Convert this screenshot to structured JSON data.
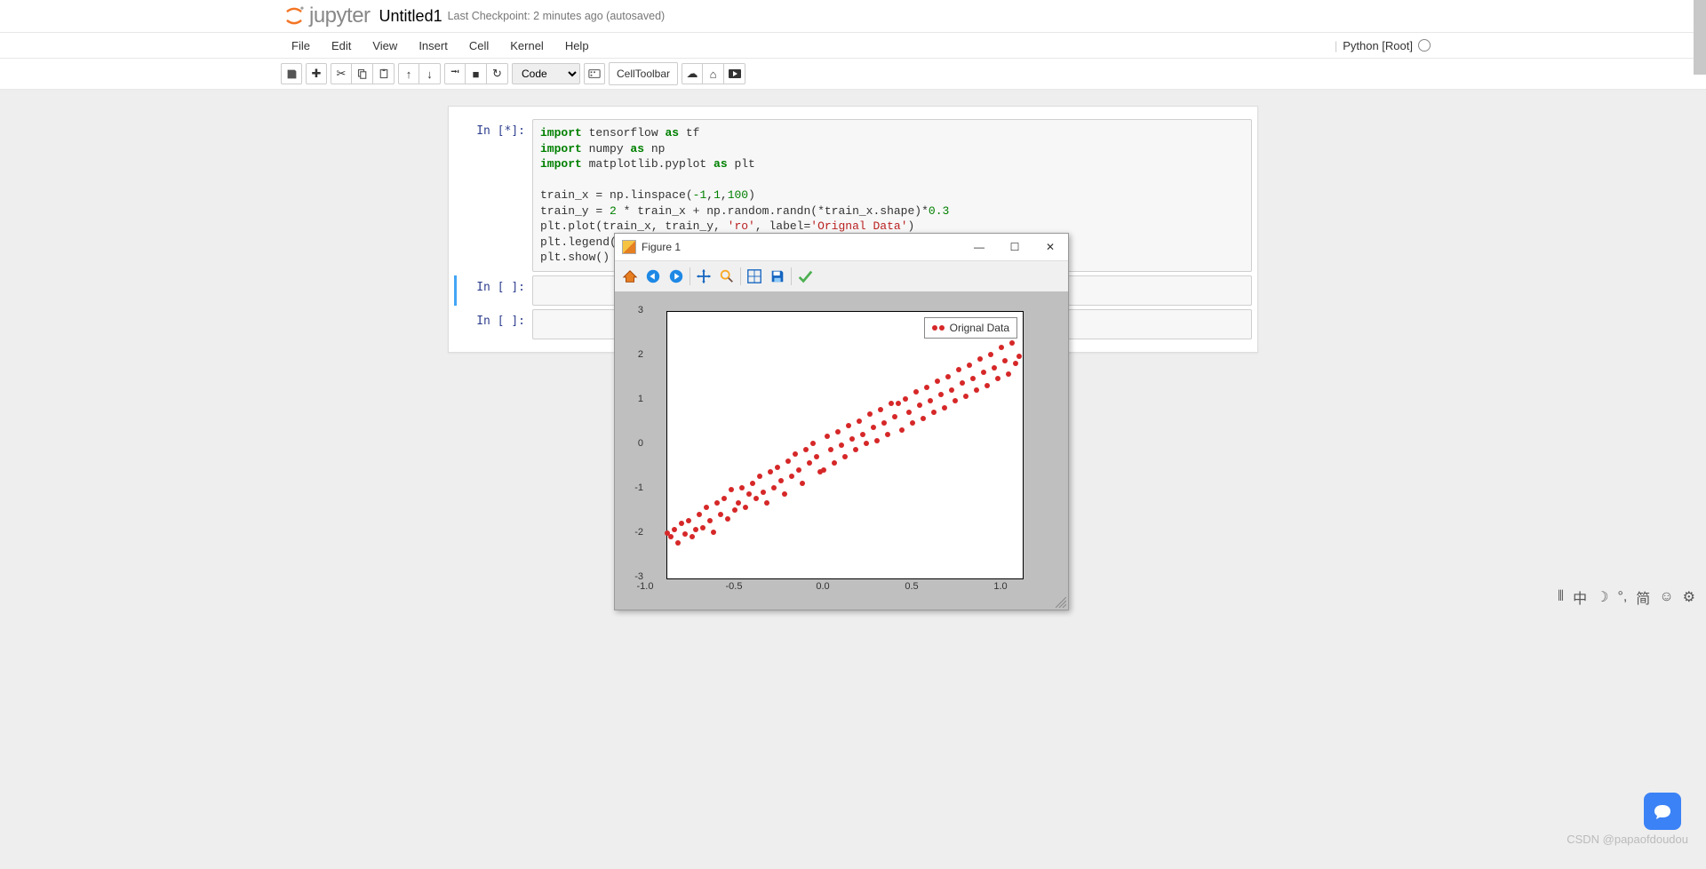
{
  "header": {
    "logo_text": "jupyter",
    "title": "Untitled1",
    "checkpoint": "Last Checkpoint: 2 minutes ago (autosaved)"
  },
  "menu": {
    "items": [
      "File",
      "Edit",
      "View",
      "Insert",
      "Cell",
      "Kernel",
      "Help"
    ],
    "kernel_label": "Python [Root]"
  },
  "toolbar": {
    "cell_type": "Code",
    "celltoolbar": "CellToolbar"
  },
  "cells": {
    "c0_prompt": "In [*]:",
    "c1_prompt": "In [ ]:",
    "c2_prompt": "In [ ]:"
  },
  "code": {
    "l1a": "import",
    "l1b": " tensorflow ",
    "l1c": "as",
    "l1d": " tf",
    "l2a": "import",
    "l2b": " numpy ",
    "l2c": "as",
    "l2d": " np",
    "l3a": "import",
    "l3b": " matplotlib.pyplot ",
    "l3c": "as",
    "l3d": " plt",
    "l5": "train_x = np.linspace(",
    "l5n1": "-1",
    "l5c1": ",",
    "l5n2": "1",
    "l5c2": ",",
    "l5n3": "100",
    "l5e": ")",
    "l6a": "train_y = ",
    "l6n1": "2",
    "l6b": " * train_x + np.random.randn(*train_x.shape)*",
    "l6n2": "0.3",
    "l7a": "plt.plot(train_x, train_y, ",
    "l7s1": "'ro'",
    "l7b": ", label=",
    "l7s2": "'Orignal Data'",
    "l7c": ")",
    "l8": "plt.legend()",
    "l9": "plt.show()"
  },
  "mpl": {
    "title": "Figure 1",
    "legend": "Orignal Data"
  },
  "chart_data": {
    "type": "scatter",
    "title": "",
    "xlabel": "",
    "ylabel": "",
    "xlim": [
      -1.0,
      1.0
    ],
    "ylim": [
      -3,
      3
    ],
    "xticks": [
      -1.0,
      -0.5,
      0.0,
      0.5,
      1.0
    ],
    "yticks": [
      -3,
      -2,
      -1,
      0,
      1,
      2,
      3
    ],
    "legend_label": "Orignal Data",
    "series": [
      {
        "name": "Orignal Data",
        "color": "#d62728",
        "marker": "o",
        "x": [
          -1.0,
          -0.98,
          -0.96,
          -0.94,
          -0.92,
          -0.9,
          -0.88,
          -0.86,
          -0.84,
          -0.82,
          -0.8,
          -0.78,
          -0.76,
          -0.74,
          -0.72,
          -0.7,
          -0.68,
          -0.66,
          -0.64,
          -0.62,
          -0.6,
          -0.58,
          -0.56,
          -0.54,
          -0.52,
          -0.5,
          -0.48,
          -0.46,
          -0.44,
          -0.42,
          -0.4,
          -0.38,
          -0.36,
          -0.34,
          -0.32,
          -0.3,
          -0.28,
          -0.26,
          -0.24,
          -0.22,
          -0.2,
          -0.18,
          -0.16,
          -0.14,
          -0.12,
          -0.1,
          -0.08,
          -0.06,
          -0.04,
          -0.02,
          0.0,
          0.02,
          0.04,
          0.06,
          0.08,
          0.1,
          0.12,
          0.14,
          0.16,
          0.18,
          0.2,
          0.22,
          0.24,
          0.26,
          0.28,
          0.3,
          0.32,
          0.34,
          0.36,
          0.38,
          0.4,
          0.42,
          0.44,
          0.46,
          0.48,
          0.5,
          0.52,
          0.54,
          0.56,
          0.58,
          0.6,
          0.62,
          0.64,
          0.66,
          0.68,
          0.7,
          0.72,
          0.74,
          0.76,
          0.78,
          0.8,
          0.82,
          0.84,
          0.86,
          0.88,
          0.9,
          0.92,
          0.94,
          0.96,
          0.98
        ],
        "y": [
          -1.98,
          -2.05,
          -1.9,
          -2.2,
          -1.75,
          -2.0,
          -1.7,
          -2.05,
          -1.9,
          -1.55,
          -1.85,
          -1.4,
          -1.7,
          -1.95,
          -1.3,
          -1.55,
          -1.2,
          -1.65,
          -1.0,
          -1.45,
          -1.3,
          -0.95,
          -1.4,
          -1.1,
          -0.85,
          -1.2,
          -0.7,
          -1.05,
          -1.3,
          -0.6,
          -0.95,
          -0.5,
          -0.8,
          -1.1,
          -0.35,
          -0.7,
          -0.2,
          -0.55,
          -0.85,
          -0.1,
          -0.4,
          0.05,
          -0.25,
          -0.6,
          -0.55,
          0.2,
          -0.1,
          -0.4,
          0.3,
          0.0,
          -0.25,
          0.45,
          0.15,
          -0.1,
          0.55,
          0.25,
          0.05,
          0.7,
          0.4,
          0.1,
          0.8,
          0.5,
          0.25,
          0.95,
          0.65,
          0.95,
          0.35,
          1.05,
          0.75,
          0.5,
          1.2,
          0.9,
          0.6,
          1.3,
          1.0,
          0.75,
          1.45,
          1.15,
          0.85,
          1.55,
          1.25,
          1.0,
          1.7,
          1.4,
          1.1,
          1.8,
          1.5,
          1.25,
          1.95,
          1.65,
          1.35,
          2.05,
          1.75,
          1.5,
          2.2,
          1.9,
          1.6,
          2.3,
          1.85,
          2.0
        ]
      }
    ]
  },
  "watermark": "CSDN @papaofdoudou",
  "ime": {
    "zh": "中",
    "jian": "简"
  }
}
